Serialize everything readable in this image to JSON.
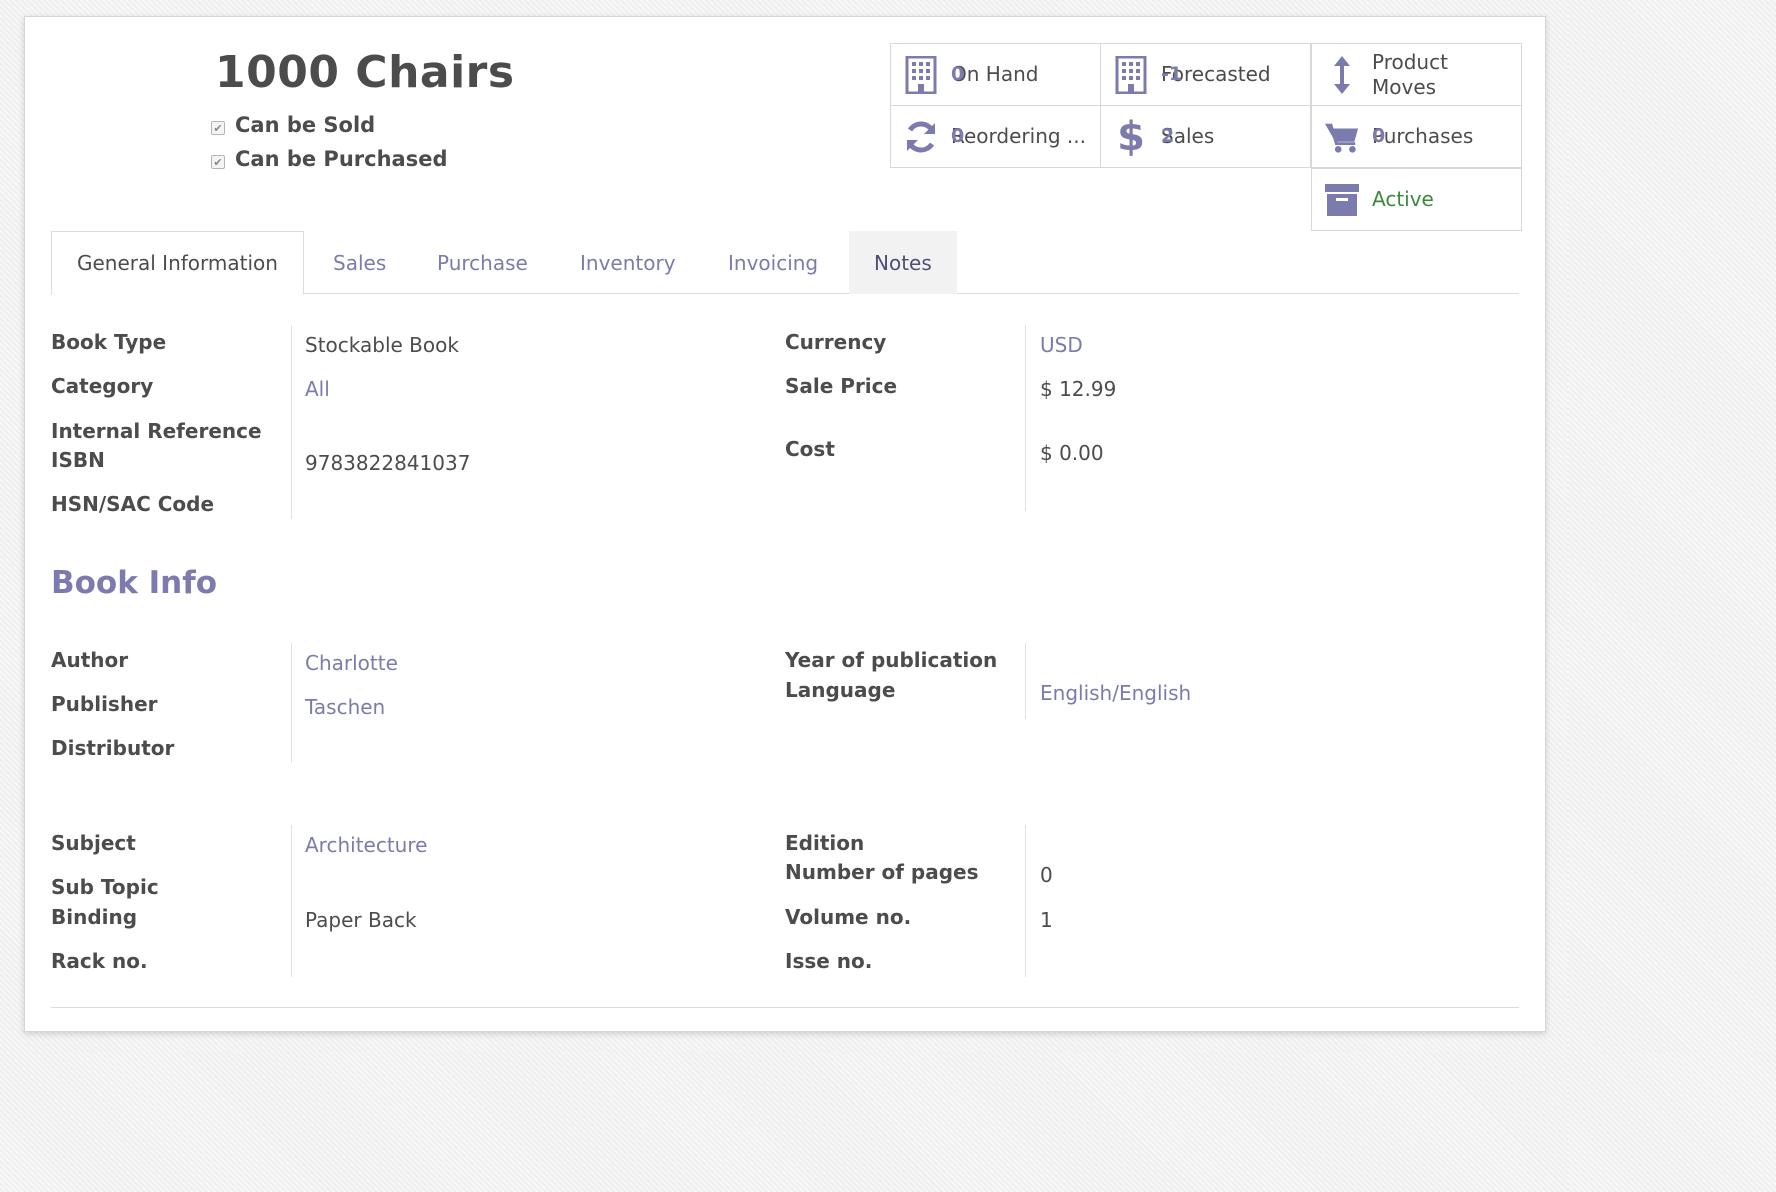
{
  "product": {
    "title": "1000 Chairs",
    "can_be_sold_label": "Can be Sold",
    "can_be_purchased_label": "Can be Purchased"
  },
  "smart_buttons": {
    "on_hand": {
      "value": "0",
      "label": "On Hand",
      "icon": "building-icon"
    },
    "forecasted": {
      "value": "-1",
      "label": "Forecasted",
      "icon": "building-icon"
    },
    "product_moves": {
      "label_line1": "Product",
      "label_line2": "Moves",
      "icon": "up-down-arrow-icon"
    },
    "reordering": {
      "value": "0",
      "label": "Reordering ...",
      "icon": "refresh-icon"
    },
    "sales": {
      "value": "2",
      "label": "Sales",
      "icon": "dollar-icon"
    },
    "purchases": {
      "value": "0",
      "label": "Purchases",
      "icon": "cart-icon"
    },
    "active": {
      "label": "Active",
      "icon": "archive-icon"
    }
  },
  "tabs": [
    "General Information",
    "Sales",
    "Purchase",
    "Inventory",
    "Invoicing",
    "Notes"
  ],
  "general": {
    "left": {
      "book_type_label": "Book Type",
      "book_type_value": "Stockable Book",
      "category_label": "Category",
      "category_value": "All",
      "internal_ref_label": "Internal Reference",
      "isbn_label": "ISBN",
      "isbn_value": "9783822841037",
      "hsn_label": "HSN/SAC Code"
    },
    "right": {
      "currency_label": "Currency",
      "currency_value": "USD",
      "sale_price_label": "Sale Price",
      "sale_price_value": "$ 12.99",
      "cost_label": "Cost",
      "cost_value": "$ 0.00"
    }
  },
  "book_info": {
    "heading": "Book Info",
    "left": {
      "author_label": "Author",
      "author_value": "Charlotte",
      "publisher_label": "Publisher",
      "publisher_value": "Taschen",
      "distributor_label": "Distributor"
    },
    "right": {
      "year_label": "Year of publication",
      "language_label": "Language",
      "language_value": "English/English"
    }
  },
  "subject_block": {
    "left": {
      "subject_label": "Subject",
      "subject_value": "Architecture",
      "subtopic_label": "Sub Topic",
      "binding_label": "Binding",
      "binding_value": "Paper Back",
      "rack_label": "Rack no."
    },
    "right": {
      "edition_label": "Edition",
      "pages_label": "Number of pages",
      "pages_value": "0",
      "volume_label": "Volume no.",
      "volume_value": "1",
      "issue_label": "Isse no."
    }
  },
  "colors": {
    "accent": "#7c7bad",
    "text": "#4c4c4c",
    "active_green": "#3b8a3b"
  }
}
